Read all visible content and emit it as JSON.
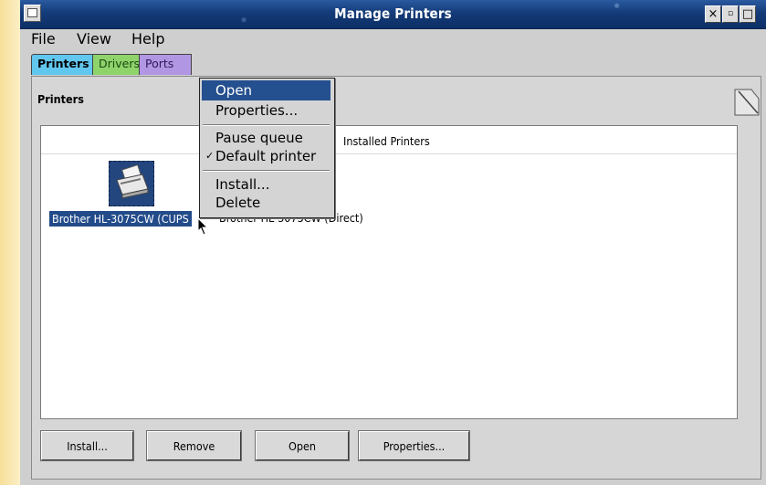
{
  "window": {
    "title": "Manage Printers"
  },
  "titlebar_buttons": [
    "×",
    "▫",
    "□"
  ],
  "menubar": {
    "items": [
      "File",
      "View",
      "Help"
    ]
  },
  "tabs": [
    "Printers",
    "Drivers",
    "Ports"
  ],
  "group": {
    "title": "Printers"
  },
  "list": {
    "column_header": "Installed Printers",
    "printer": {
      "name": "Brother HL-3075CW (CUPS",
      "description": "Brother HL-3075CW (Direct)"
    }
  },
  "context_menu": {
    "items": [
      "Open",
      "Properties...",
      "Pause queue",
      "Default printer",
      "Install...",
      "Delete"
    ],
    "checked": "Default printer"
  },
  "buttons": [
    "Install...",
    "Remove",
    "Open",
    "Properties..."
  ],
  "colors": {
    "tab_printers": "#62c7ee",
    "tab_drivers": "#8fd36b",
    "tab_ports": "#b196e3",
    "selection": "#234b8a",
    "titlebar": "#143b78"
  }
}
